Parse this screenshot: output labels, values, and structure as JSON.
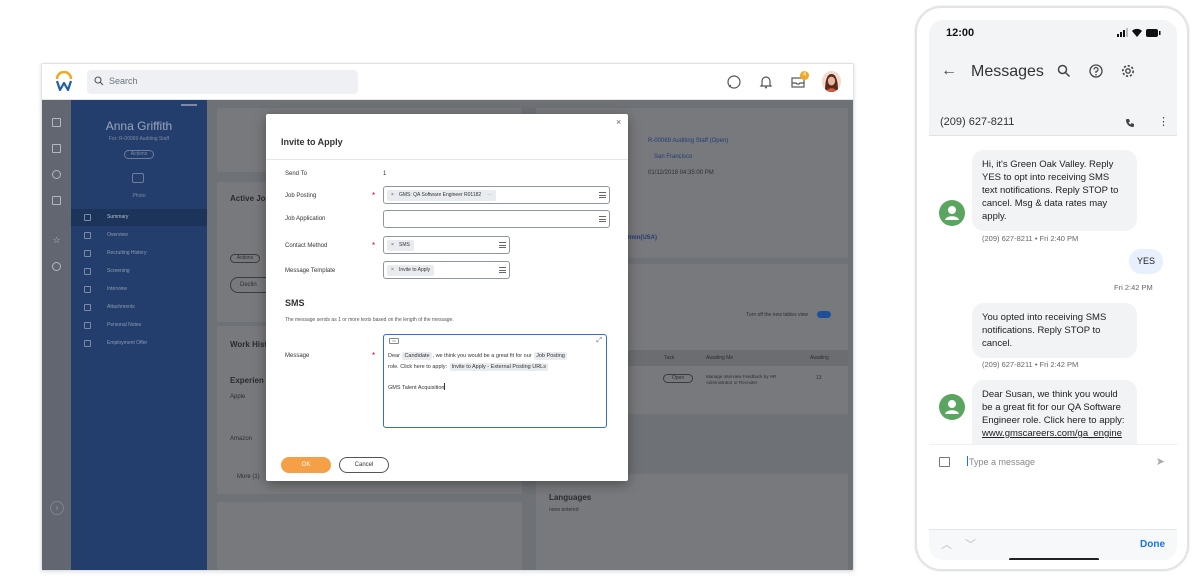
{
  "workday": {
    "search_placeholder": "Search",
    "notification_badge": "4",
    "sidebar": {
      "name": "Anna Griffith",
      "subtitle": "For: R-00069 Auditing Staff",
      "actions_label": "Actions",
      "photo_label": "Photo",
      "nav": [
        "Summary",
        "Overview",
        "Recruiting History",
        "Screening",
        "Interview",
        "Attachments",
        "Personal Notes",
        "Employment Offer"
      ]
    },
    "background": {
      "active_jobs": "Active Jo",
      "work_history": "Work Hist",
      "experience": "Experien",
      "job_posting_link": "R-00069 Auditing Staff (Open)",
      "location": "San Francisco",
      "date": "01/12/2018 04:35:00 PM",
      "admin_snip": "dmin(USA)",
      "languages": "Languages",
      "languages_note": "none entered",
      "actions": "Actions",
      "decline": "Declin",
      "apple": "Apple",
      "amazon": "Amazon",
      "more": "More (1)",
      "table_headers": [
        "Task",
        "Awaiting Me",
        "Awaiting"
      ],
      "table_row": {
        "status": "Open",
        "task": "Manage Interview Feedback by HR Administrator or Recruiter",
        "days": "13"
      },
      "turn_off_label": "Turn off the new tables view"
    },
    "modal": {
      "title": "Invite to Apply",
      "close": "×",
      "send_to_label": "Send To",
      "send_to_value": "1",
      "job_posting_label": "Job Posting",
      "job_posting_value": "GMS: QA Software Engineer R01182",
      "job_application_label": "Job Application",
      "contact_method_label": "Contact Method",
      "contact_method_value": "SMS",
      "message_template_label": "Message Template",
      "message_template_value": "Invite to Apply",
      "sms_title": "SMS",
      "sms_note": "The message sends as 1 or more texts based on the length of the message.",
      "message_label": "Message",
      "message": {
        "dear": "Dear",
        "candidate_tag": "Candidate",
        "text1": ", we think you would be a great fit for our",
        "job_posting_tag": "Job Posting",
        "text2": "role. Click here to apply:",
        "urls_tag": "Invite to Apply - External Posting URLs",
        "signature": "GMS Talent Acquisition"
      },
      "ok": "OK",
      "cancel": "Cancel"
    }
  },
  "phone": {
    "time": "12:00",
    "title": "Messages",
    "number": "(209) 627-8211",
    "messages": [
      {
        "text": "Hi, it's Green Oak Valley. Reply YES to opt into receiving SMS text notifications. Reply STOP to cancel. Msg & data rates may apply.",
        "meta": "(209) 627-8211 • Fri 2:40 PM"
      },
      {
        "text": "YES",
        "meta": "Fri 2:42 PM"
      },
      {
        "text": "You opted into receiving SMS notifications. Reply STOP to cancel.",
        "meta": "(209) 627-8211 • Fri 2:42 PM"
      },
      {
        "text": "Dear Susan, we think you would be a great fit for our QA Software Engineer role. Click here to apply:",
        "link": "www.gmscareers.com/ga_engine"
      }
    ],
    "compose_placeholder": "Type a message",
    "done": "Done"
  }
}
